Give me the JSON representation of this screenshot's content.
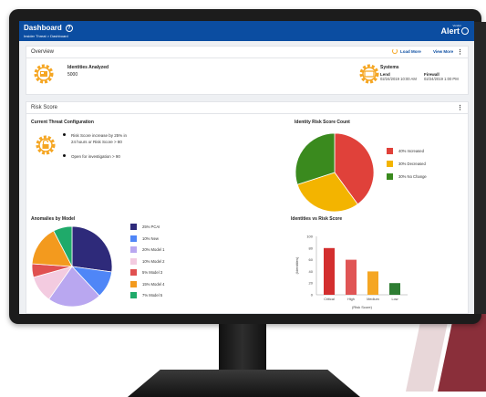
{
  "header": {
    "title": "Dashboard",
    "help_icon": "?",
    "breadcrumb": "Insider Threat > Dashboard",
    "brand_small": "Vendor",
    "brand": "Alert"
  },
  "overview": {
    "title": "Overview",
    "load_more": "Load More",
    "view_more": "View More",
    "kebab": "⋮",
    "identities_label": "Identities Analyzed",
    "identities_value": "5000",
    "systems_label": "Systems",
    "system1_name": "Lend",
    "system1_time": "02/24/2019 10:00 AM",
    "system2_name": "Firewall",
    "system2_time": "02/24/2019 1:00 PM"
  },
  "risk": {
    "title": "Risk Score",
    "kebab": "⋮",
    "config_title": "Current Threat Configuration",
    "bullet1_line1": "Risk Score increase by 25% in",
    "bullet1_line2": "24 hours or Risk Score > 80",
    "bullet2": "Open for investigation > 90",
    "count_title": "Identity Risk Score Count",
    "anomalies_title": "Anomalies by Model",
    "ivr_title": "Identities vs Risk Score"
  },
  "colors": {
    "brand_blue": "#0b4da1",
    "accent_orange": "#f5a623",
    "increased": "#e0413a",
    "decreased": "#f3b400",
    "no_change": "#3a8a1e",
    "bar": "#d32f2f",
    "bar_orange": "#f5a623",
    "bar_green": "#2e7d32"
  },
  "chart_data": [
    {
      "type": "pie",
      "title": "Identity Risk Score Count",
      "categories": [
        "40% Increased",
        "30% Decreased",
        "30% No Change"
      ],
      "values": [
        40,
        30,
        30
      ],
      "colors": [
        "#e0413a",
        "#f3b400",
        "#3a8a1e"
      ]
    },
    {
      "type": "pie",
      "title": "Anomalies by Model",
      "categories": [
        "25% PCAI",
        "10% New",
        "20% Model 1",
        "10% Model 2",
        "5% Model 3",
        "15% Model 4",
        "7% Model 5"
      ],
      "values": [
        25,
        10,
        20,
        10,
        5,
        15,
        7
      ],
      "colors": [
        "#2e2a7a",
        "#4f86f7",
        "#b9a7f0",
        "#f3cbe0",
        "#e05050",
        "#f39a1e",
        "#1faa6a"
      ]
    },
    {
      "type": "bar",
      "title": "Identities vs Risk Score",
      "categories": [
        "Critical",
        "High",
        "Medium",
        "Low"
      ],
      "values": [
        80,
        60,
        40,
        20
      ],
      "colors": [
        "#d32f2f",
        "#e05555",
        "#f5a623",
        "#2e7d32"
      ],
      "ylim": [
        0,
        100
      ],
      "yticks": [
        "0",
        "20",
        "40",
        "60",
        "80",
        "100"
      ],
      "xlabel": "(Risk Score)",
      "ylabel": "(Identities)"
    }
  ]
}
